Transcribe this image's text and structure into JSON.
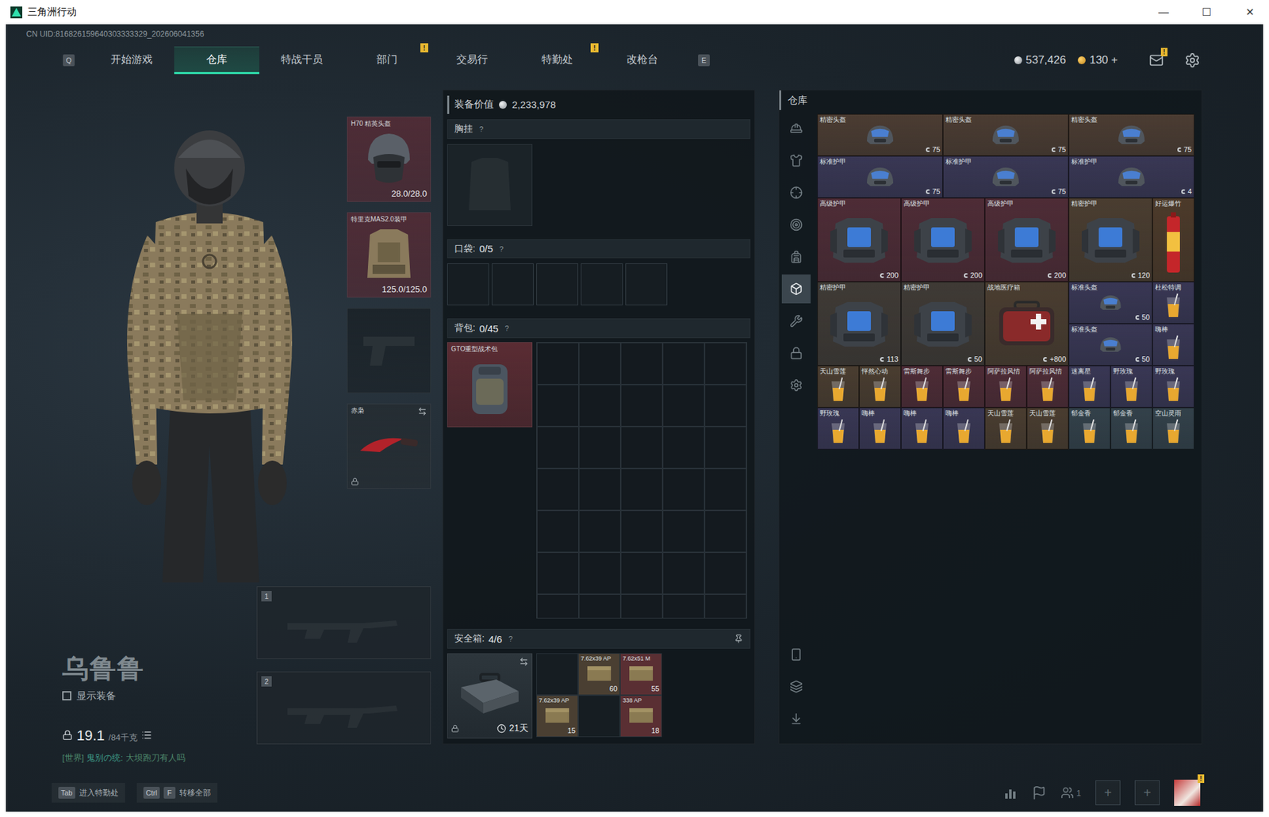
{
  "window": {
    "title": "三角洲行动",
    "controls": [
      "—",
      "☐",
      "✕"
    ]
  },
  "uid": "CN UID:816826159640303333329_202606041356",
  "nav": {
    "left_key": "Q",
    "right_key": "E",
    "tabs": [
      {
        "label": "开始游戏",
        "selected": false,
        "badge": ""
      },
      {
        "label": "仓库",
        "selected": true,
        "badge": ""
      },
      {
        "label": "特战干员",
        "selected": false,
        "badge": ""
      },
      {
        "label": "部门",
        "selected": false,
        "badge": "!"
      },
      {
        "label": "交易行",
        "selected": false,
        "badge": ""
      },
      {
        "label": "特勤处",
        "selected": false,
        "badge": "!"
      },
      {
        "label": "改枪台",
        "selected": false,
        "badge": ""
      }
    ]
  },
  "currency": {
    "silver": "537,426",
    "gold": "130",
    "add": "+",
    "mail_badge": "!"
  },
  "character": {
    "name": "乌鲁鲁",
    "show_gear": {
      "label": "显示装备",
      "checked": false
    },
    "weight": "19.1",
    "capacity": "/84千克",
    "chat": {
      "channel": "[世界]",
      "sender": "鬼别の统:",
      "message": "大坝跑刀有人吗"
    }
  },
  "equipment": [
    {
      "kind": "helmet",
      "label": "H70 精英头盔",
      "durability": "28.0/28.0",
      "color": "#4e2c36",
      "locked": false
    },
    {
      "kind": "armor",
      "label": "特里克MAS2.0装甲",
      "durability": "125.0/125.0",
      "color": "#4e2c36",
      "locked": false
    },
    {
      "kind": "pistol",
      "label": "",
      "durability": "",
      "color": "#1c242a",
      "locked": false
    },
    {
      "kind": "knife",
      "label": "赤枭",
      "durability": "",
      "color": "#252d33",
      "locked": true
    }
  ],
  "weapon_slots": [
    {
      "number": "1"
    },
    {
      "number": "2"
    }
  ],
  "loadout": {
    "value_label": "装备价值",
    "value": "2,233,978",
    "chest": {
      "label": "胸挂",
      "help": "?"
    },
    "pockets": {
      "label": "口袋:",
      "count": "0/5",
      "help": "?",
      "slots": 5
    },
    "backpack": {
      "label": "背包:",
      "count": "0/45",
      "help": "?",
      "slots": 45,
      "item": "GTO重型战术包",
      "color": "#5a2c33"
    },
    "safe": {
      "label": "安全箱:",
      "count": "4/6",
      "help": "?",
      "timer": "21天",
      "locked": true,
      "cells": [
        {
          "empty": true,
          "label": "",
          "count": "",
          "color": "#161d22"
        },
        {
          "empty": false,
          "label": "7.62x39 AP",
          "count": "60",
          "color": "#4a3f32"
        },
        {
          "empty": false,
          "label": "7.62x51 M",
          "count": "55",
          "color": "#5a2f33"
        },
        {
          "empty": false,
          "label": "7.62x39 AP",
          "count": "15",
          "color": "#4a3f32"
        },
        {
          "empty": true,
          "label": "",
          "count": "",
          "color": "#161d22"
        },
        {
          "empty": false,
          "label": "338 AP",
          "count": "18",
          "color": "#5a2f33"
        }
      ]
    }
  },
  "warehouse": {
    "title": "仓库",
    "sidebar_top": [
      {
        "selected": false
      },
      {
        "selected": false
      },
      {
        "selected": false
      },
      {
        "selected": false
      },
      {
        "selected": false
      },
      {
        "selected": true
      },
      {
        "selected": false
      },
      {
        "selected": false
      },
      {
        "selected": false
      }
    ],
    "sidebar_bottom": [
      {
        "selected": false
      },
      {
        "selected": false
      },
      {
        "selected": false
      }
    ],
    "items": [
      {
        "name": "精密头盔",
        "value": "75",
        "kind": "helmet",
        "color": "#4b3c32"
      },
      {
        "name": "精密头盔",
        "value": "75",
        "kind": "helmet",
        "color": "#4b3c32"
      },
      {
        "name": "精密头盔",
        "value": "75",
        "kind": "helmet",
        "color": "#4b3c32"
      },
      {
        "name": "标准护甲",
        "value": "75",
        "kind": "helmet",
        "color": "#393754"
      },
      {
        "name": "标准护甲",
        "value": "75",
        "kind": "helmet",
        "color": "#393754"
      },
      {
        "name": "标准护甲",
        "value": "4",
        "kind": "helmet",
        "color": "#393754"
      },
      {
        "name": "高级护甲",
        "value": "200",
        "kind": "armor",
        "color": "#4e2c36"
      },
      {
        "name": "高级护甲",
        "value": "200",
        "kind": "armor",
        "color": "#4e2c36"
      },
      {
        "name": "高级护甲",
        "value": "200",
        "kind": "armor",
        "color": "#4e2c36"
      },
      {
        "name": "精密护甲",
        "value": "120",
        "kind": "armor",
        "color": "#4a3d30"
      },
      {
        "name": "好运爆竹",
        "value": "",
        "kind": "firework",
        "color": "#4c3a2a"
      },
      {
        "name": "精密护甲",
        "value": "113",
        "kind": "armor",
        "color": "#3f3a35"
      },
      {
        "name": "精密护甲",
        "value": "50",
        "kind": "armor",
        "color": "#3f3a35"
      },
      {
        "name": "战地医疗箱",
        "value": "+800",
        "kind": "medkit",
        "color": "#4a3d30"
      },
      {
        "name": "标准头盔",
        "value": "50",
        "kind": "smallhelmet",
        "color": "#393754"
      },
      {
        "name": "杜松特调",
        "value": "",
        "kind": "drink",
        "color": "#393754"
      },
      {
        "name": "标准头盔",
        "value": "50",
        "kind": "smallhelmet",
        "color": "#393754"
      },
      {
        "name": "嗨棒",
        "value": "",
        "kind": "drink",
        "color": "#393754"
      },
      {
        "name": "天山雪莲",
        "value": "",
        "kind": "drink",
        "color": "#4a3d30"
      },
      {
        "name": "怦然心动",
        "value": "",
        "kind": "drink",
        "color": "#4a3d30"
      },
      {
        "name": "雷斯舞步",
        "value": "",
        "kind": "drink",
        "color": "#4e2c36"
      },
      {
        "name": "雷斯舞步",
        "value": "",
        "kind": "drink",
        "color": "#4e2c36"
      },
      {
        "name": "阿萨拉风情",
        "value": "",
        "kind": "drink",
        "color": "#4e2c36"
      },
      {
        "name": "阿萨拉风情",
        "value": "",
        "kind": "drink",
        "color": "#4e2c36"
      },
      {
        "name": "迷离星",
        "value": "",
        "kind": "drink",
        "color": "#393754"
      },
      {
        "name": "野玫瑰",
        "value": "",
        "kind": "drink",
        "color": "#393754"
      },
      {
        "name": "野玫瑰",
        "value": "",
        "kind": "drink",
        "color": "#393754"
      },
      {
        "name": "野玫瑰",
        "value": "",
        "kind": "drink",
        "color": "#393754"
      },
      {
        "name": "嗨棒",
        "value": "",
        "kind": "drink",
        "color": "#393754"
      },
      {
        "name": "嗨棒",
        "value": "",
        "kind": "drink",
        "color": "#393754"
      },
      {
        "name": "嗨棒",
        "value": "",
        "kind": "drink",
        "color": "#393754"
      },
      {
        "name": "天山雪莲",
        "value": "",
        "kind": "drink",
        "color": "#4a3d30"
      },
      {
        "name": "天山雪莲",
        "value": "",
        "kind": "drink",
        "color": "#4a3d30"
      },
      {
        "name": "郁金香",
        "value": "",
        "kind": "drink",
        "color": "#33414a"
      },
      {
        "name": "郁金香",
        "value": "",
        "kind": "drink",
        "color": "#33414a"
      },
      {
        "name": "空山灵雨",
        "value": "",
        "kind": "drink",
        "color": "#33414a"
      }
    ]
  },
  "bottom_bar": {
    "hints": [
      {
        "keys": [
          "Tab"
        ],
        "label": "进入特勤处"
      },
      {
        "keys": [
          "Ctrl",
          "F"
        ],
        "label": "转移全部"
      }
    ],
    "squad_count": "1",
    "invite_slots": [
      "+",
      "+"
    ],
    "avatar_badge": "!"
  }
}
